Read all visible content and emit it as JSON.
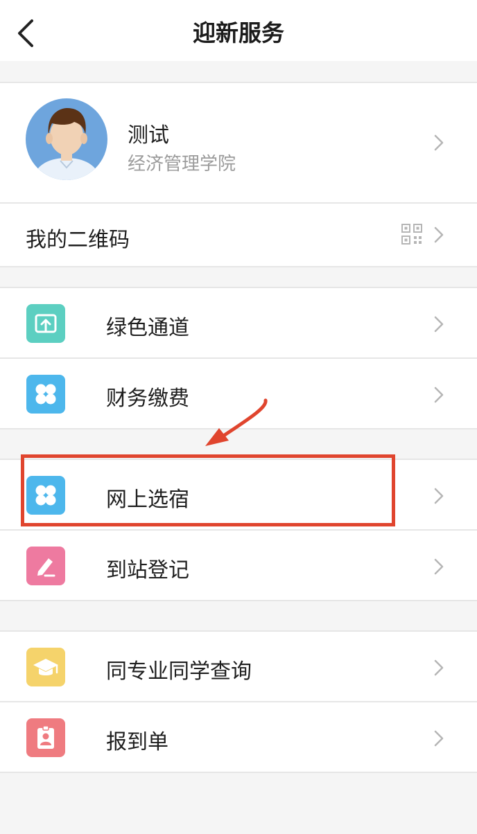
{
  "header": {
    "title": "迎新服务",
    "back_icon": "chevron-left-icon"
  },
  "profile": {
    "name": "测试",
    "college": "经济管理学院",
    "avatar_icon": "user-avatar-icon"
  },
  "qrcode": {
    "label": "我的二维码",
    "icon": "qr-code-icon"
  },
  "groups": [
    {
      "items": [
        {
          "label": "绿色通道",
          "icon": "green-channel-icon",
          "color": "#5ccfc1"
        },
        {
          "label": "财务缴费",
          "icon": "clover-icon",
          "color": "#4db7ec"
        }
      ]
    },
    {
      "items": [
        {
          "label": "网上选宿",
          "icon": "clover-icon",
          "color": "#4db7ec"
        },
        {
          "label": "到站登记",
          "icon": "pencil-icon",
          "color": "#ee7aa0"
        }
      ]
    },
    {
      "items": [
        {
          "label": "同专业同学查询",
          "icon": "graduation-cap-icon",
          "color": "#f5d36b"
        },
        {
          "label": "报到单",
          "icon": "id-badge-icon",
          "color": "#ef7b80"
        }
      ]
    }
  ],
  "annotation": {
    "highlight_color": "#e0452e"
  }
}
